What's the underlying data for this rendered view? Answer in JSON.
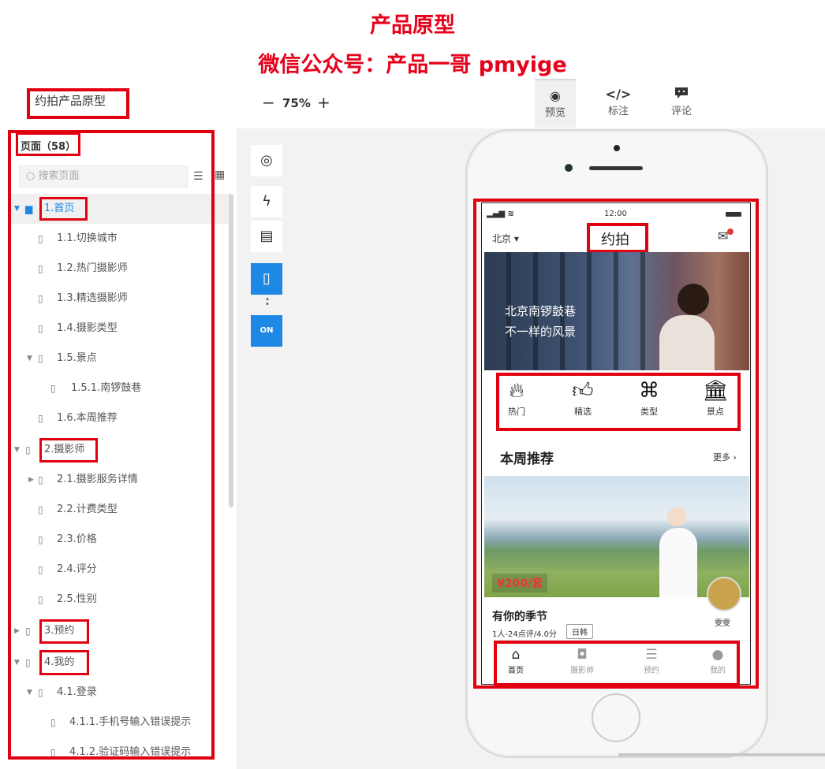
{
  "banner": {
    "line1": "产品原型",
    "line2": "微信公众号：产品一哥 pmyige"
  },
  "toolbar": {
    "project_title": "约拍产品原型",
    "zoom_minus": "−",
    "zoom_value": "75%",
    "zoom_plus": "+",
    "modes": [
      {
        "label": "预览",
        "icon": "eye-icon",
        "active": true
      },
      {
        "label": "标注",
        "icon": "code-icon",
        "active": false
      },
      {
        "label": "评论",
        "icon": "comment-icon",
        "active": false
      }
    ]
  },
  "pages": {
    "header": "页面（58）",
    "search_placeholder": "搜索页面",
    "items": [
      {
        "label": "1.首页",
        "depth": 0,
        "expanded": true,
        "selected": true
      },
      {
        "label": "1.1.切换城市",
        "depth": 1
      },
      {
        "label": "1.2.热门摄影师",
        "depth": 1
      },
      {
        "label": "1.3.精选摄影师",
        "depth": 1
      },
      {
        "label": "1.4.摄影类型",
        "depth": 1
      },
      {
        "label": "1.5.景点",
        "depth": 1,
        "expanded": true
      },
      {
        "label": "1.5.1.南锣鼓巷",
        "depth": 2
      },
      {
        "label": "1.6.本周推荐",
        "depth": 1
      },
      {
        "label": "2.摄影师",
        "depth": 0,
        "expanded": true
      },
      {
        "label": "2.1.摄影服务详情",
        "depth": 1,
        "expanded": false
      },
      {
        "label": "2.2.计费类型",
        "depth": 1
      },
      {
        "label": "2.3.价格",
        "depth": 1
      },
      {
        "label": "2.4.评分",
        "depth": 1
      },
      {
        "label": "2.5.性别",
        "depth": 1
      },
      {
        "label": "3.预约",
        "depth": 0,
        "expanded": false
      },
      {
        "label": "4.我的",
        "depth": 0,
        "expanded": true
      },
      {
        "label": "4.1.登录",
        "depth": 1,
        "expanded": true
      },
      {
        "label": "4.1.1.手机号输入错误提示",
        "depth": 2
      },
      {
        "label": "4.1.2.验证码输入错误提示",
        "depth": 2
      }
    ]
  },
  "side_tools": [
    {
      "icon": "target-icon"
    },
    {
      "icon": "bolt-icon"
    },
    {
      "icon": "notes-icon"
    },
    {
      "icon": "phone-device-icon",
      "active": true
    },
    {
      "icon": "on-toggle-icon",
      "label": "ON",
      "active": true
    }
  ],
  "app": {
    "status_time": "12:00",
    "city": "北京",
    "title": "约拍",
    "banner_line1": "北京南锣鼓巷",
    "banner_line2": "不一样的风景",
    "categories": [
      {
        "label": "热门",
        "icon": "fire-icon"
      },
      {
        "label": "精选",
        "icon": "thumbs-up-icon"
      },
      {
        "label": "类型",
        "icon": "grid-clover-icon"
      },
      {
        "label": "景点",
        "icon": "landmark-icon"
      }
    ],
    "weekly_title": "本周推荐",
    "more_label": "更多",
    "price": "¥200/套",
    "card_title": "有你的季节",
    "card_meta": "1人-24点评/4.0分",
    "card_tag": "日韩",
    "photographer": "雯雯",
    "tabs": [
      {
        "label": "首页",
        "icon": "home-icon",
        "active": true
      },
      {
        "label": "摄影师",
        "icon": "camera-icon"
      },
      {
        "label": "预约",
        "icon": "list-icon"
      },
      {
        "label": "我的",
        "icon": "user-icon"
      }
    ]
  },
  "colors": {
    "annotation_red": "#e0000f",
    "accent_blue": "#1e88e5",
    "price_red": "#e53935"
  }
}
